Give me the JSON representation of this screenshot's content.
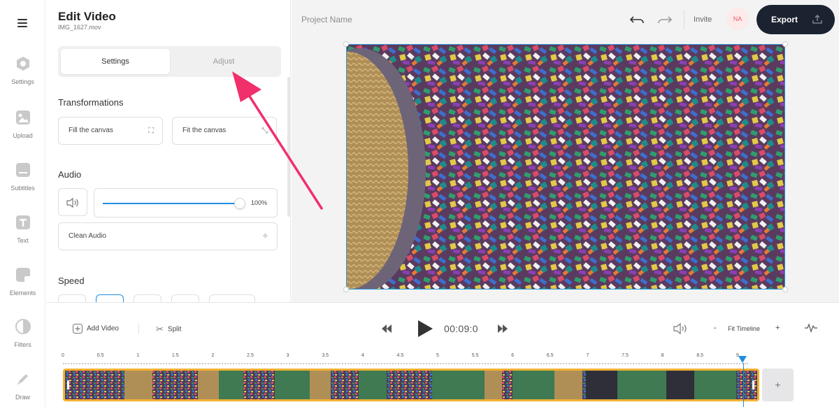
{
  "sidebar": {
    "items": [
      {
        "label": "Settings",
        "icon": "settings-icon"
      },
      {
        "label": "Upload",
        "icon": "upload-icon"
      },
      {
        "label": "Subtitles",
        "icon": "subtitles-icon"
      },
      {
        "label": "Text",
        "icon": "text-icon"
      },
      {
        "label": "Elements",
        "icon": "elements-icon"
      },
      {
        "label": "Filters",
        "icon": "filters-icon"
      },
      {
        "label": "Draw",
        "icon": "draw-icon"
      }
    ]
  },
  "panel": {
    "title": "Edit Video",
    "filename": "IMG_1627.mov",
    "tabs": [
      {
        "label": "Settings",
        "active": true
      },
      {
        "label": "Adjust",
        "active": false
      }
    ],
    "transformations": {
      "title": "Transformations",
      "fill_label": "Fill the canvas",
      "fit_label": "Fit the canvas"
    },
    "audio": {
      "title": "Audio",
      "volume": "100%",
      "clean_label": "Clean Audio"
    },
    "speed": {
      "title": "Speed"
    }
  },
  "topbar": {
    "project_name": "Project Name",
    "invite_label": "Invite",
    "avatar_initials": "NA",
    "export_label": "Export"
  },
  "timeline": {
    "add_video_label": "Add Video",
    "split_label": "Split",
    "time": "00:09:0",
    "zoom_out": "-",
    "zoom_in": "+",
    "fit_label": "Fit Timeline",
    "add_clip": "+",
    "ruler": [
      "0",
      "0.5",
      "1",
      "1.5",
      "2",
      "2.5",
      "3",
      "3.5",
      "4",
      "4.5",
      "5",
      "5.5",
      "6",
      "6.5",
      "7",
      "7.5",
      "8",
      "8.5",
      "9"
    ]
  },
  "colors": {
    "accent_blue": "#1f8ee0",
    "clip_border": "#f2b233",
    "export_bg": "#1b2230",
    "annotation_arrow": "#f0306b"
  }
}
